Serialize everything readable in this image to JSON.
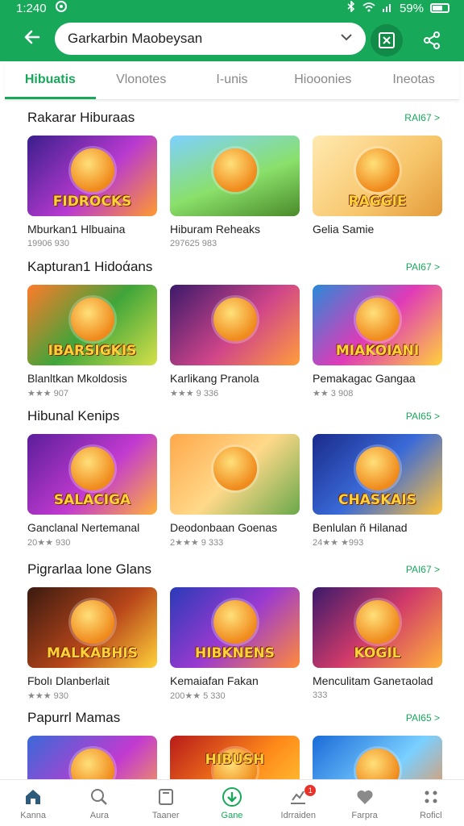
{
  "status": {
    "time": "1:240",
    "battery": "59%"
  },
  "header": {
    "search_value": "Garkarbin Maobeysan"
  },
  "tabs": [
    {
      "label": "Hibuatis"
    },
    {
      "label": "Vlonotes"
    },
    {
      "label": "I-unis"
    },
    {
      "label": "Hiooonies"
    },
    {
      "label": "Ineotas"
    }
  ],
  "sections": [
    {
      "title": "Rakarar Hiburaas",
      "more": "RAI67 >",
      "cards": [
        {
          "title": "Mburkan1 Hlbuaina",
          "meta": "19906 930",
          "badge": "FIDROCKS"
        },
        {
          "title": "Hiburam Reheaks",
          "meta": "297625 983",
          "badge": ""
        },
        {
          "title": "Gelia Samie",
          "meta": "",
          "badge": "RAGGIE"
        }
      ]
    },
    {
      "title": "Kapturan1 Hidoάans",
      "more": "PAI67 >",
      "cards": [
        {
          "title": "Blanltkan Mkoldosis",
          "meta": "★★★ 907",
          "badge": "IBARSIGKIS"
        },
        {
          "title": "Karlikang Pranola",
          "meta": "★★★ 9 336",
          "badge": ""
        },
        {
          "title": "Pemakagac Gangaa",
          "meta": "★★ 3 908",
          "badge": "MIAKOIANI"
        }
      ]
    },
    {
      "title": "Hibunal Kenips",
      "more": "PAI65 >",
      "cards": [
        {
          "title": "Ganclanal Nertemanal",
          "meta": "20★★ 930",
          "badge": "SALACIGA"
        },
        {
          "title": "Deodonbaan Goenas",
          "meta": "2★★★ 9 333",
          "badge": ""
        },
        {
          "title": "Benlulan ñ Hilanad",
          "meta": "24★★ ★993",
          "badge": "CHASKAIS"
        }
      ]
    },
    {
      "title": "Pigrarlaa lone Glans",
      "more": "PAI67 >",
      "cards": [
        {
          "title": "Fbolı Dlanberlait",
          "meta": "★★★ 930",
          "badge": "MALKABHIS"
        },
        {
          "title": "Kemaiafan Fakan",
          "meta": "200★★ 5 330",
          "badge": "HIBKNENS"
        },
        {
          "title": "Menculitam Ganeτaolad",
          "meta": "333",
          "badge": "KOGIL"
        }
      ]
    },
    {
      "title": "Papurrl Mamas",
      "more": "PAI65 >",
      "cards": [
        {
          "title": "",
          "meta": "",
          "badge": ""
        },
        {
          "title": "",
          "meta": "",
          "badge": "HIBUSH"
        },
        {
          "title": "",
          "meta": "",
          "badge": ""
        }
      ]
    }
  ],
  "bottom_nav": [
    {
      "label": "Kanna",
      "icon": "home-icon"
    },
    {
      "label": "Aura",
      "icon": "search-icon"
    },
    {
      "label": "Taaner",
      "icon": "tablet-icon"
    },
    {
      "label": "Gane",
      "icon": "download-icon"
    },
    {
      "label": "Idrraiden",
      "icon": "updates-icon",
      "badge": "1"
    },
    {
      "label": "Farpra",
      "icon": "heart-icon"
    },
    {
      "label": "Roficl",
      "icon": "grid-icon"
    }
  ]
}
